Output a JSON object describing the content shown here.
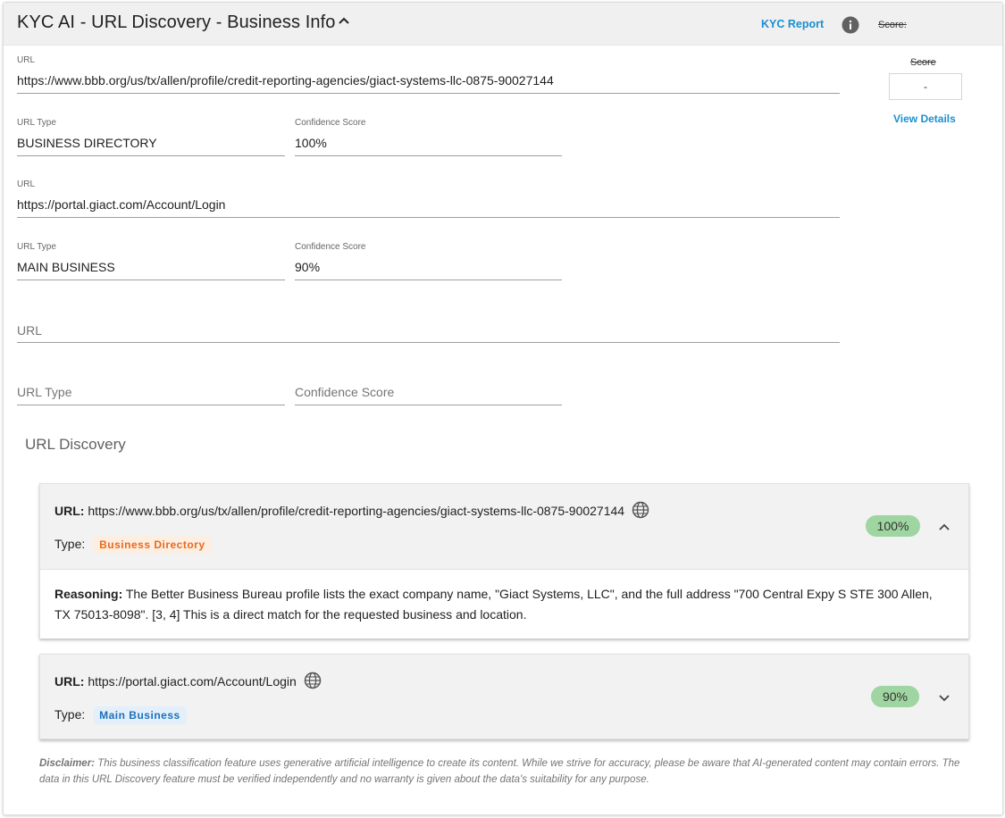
{
  "header": {
    "title": "KYC AI - URL Discovery - Business Info",
    "kyc_report_label": "KYC Report",
    "score_label": "Score:"
  },
  "fields": {
    "url1": {
      "label": "URL",
      "value": "https://www.bbb.org/us/tx/allen/profile/credit-reporting-agencies/giact-systems-llc-0875-90027144"
    },
    "url_type1": {
      "label": "URL Type",
      "value": "BUSINESS DIRECTORY"
    },
    "confidence1": {
      "label": "Confidence Score",
      "value": "100%"
    },
    "url2": {
      "label": "URL",
      "value": "https://portal.giact.com/Account/Login"
    },
    "url_type2": {
      "label": "URL Type",
      "value": "MAIN BUSINESS"
    },
    "confidence2": {
      "label": "Confidence Score",
      "value": "90%"
    },
    "url3": {
      "placeholder": "URL"
    },
    "url_type3": {
      "placeholder": "URL Type"
    },
    "confidence3": {
      "placeholder": "Confidence Score"
    }
  },
  "score_panel": {
    "label": "Score",
    "value": "-",
    "view_details": "View Details"
  },
  "discovery": {
    "title": "URL Discovery",
    "url_prefix": "URL:",
    "type_prefix": "Type:",
    "reasoning_prefix": "Reasoning:",
    "items": [
      {
        "url": "https://www.bbb.org/us/tx/allen/profile/credit-reporting-agencies/giact-systems-llc-0875-90027144",
        "type": "Business Directory",
        "confidence": "100%",
        "expanded": true,
        "reasoning": "The Better Business Bureau profile lists the exact company name, \"Giact Systems, LLC\", and the full address \"700 Central Expy S STE 300 Allen, TX 75013-8098\". [3, 4] This is a direct match for the requested business and location."
      },
      {
        "url": "https://portal.giact.com/Account/Login",
        "type": "Main Business",
        "confidence": "90%",
        "expanded": false
      }
    ]
  },
  "disclaimer": {
    "prefix": "Disclaimer:",
    "text": "This business classification feature uses generative artificial intelligence to create its content. While we strive for accuracy, please be aware that AI-generated content may contain errors. The data in this URL Discovery feature must be verified independently and no warranty is given about the data's suitability for any purpose."
  },
  "colors": {
    "link": "#1a8fd1",
    "confidence_pill": "#9ed5a0",
    "chip_directory_bg": "#fdeee2",
    "chip_directory_text": "#e86a1c",
    "chip_main_bg": "#e3f0fb",
    "chip_main_text": "#1e6fb8"
  }
}
